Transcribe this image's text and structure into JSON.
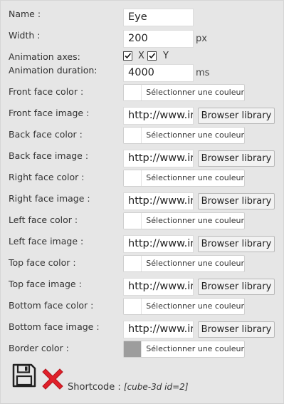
{
  "form": {
    "name": {
      "label": "Name :",
      "value": "Eye"
    },
    "width": {
      "label": "Width :",
      "value": "200",
      "unit": "px"
    },
    "animation_axes": {
      "label": "Animation axes:",
      "x_label": "X",
      "y_label": "Y",
      "x_checked": true,
      "y_checked": true
    },
    "animation_duration": {
      "label": "Animation duration:",
      "value": "4000",
      "unit": "ms"
    },
    "front_color": {
      "label": "Front face color :",
      "button": "Sélectionner une couleur"
    },
    "front_image": {
      "label": "Front face image :",
      "value": "http://www.in",
      "button": "Browser library"
    },
    "back_color": {
      "label": "Back face color :",
      "button": "Sélectionner une couleur"
    },
    "back_image": {
      "label": "Back face image :",
      "value": "http://www.in",
      "button": "Browser library"
    },
    "right_color": {
      "label": "Right face color :",
      "button": "Sélectionner une couleur"
    },
    "right_image": {
      "label": "Right face image :",
      "value": "http://www.in",
      "button": "Browser library"
    },
    "left_color": {
      "label": "Left face color :",
      "button": "Sélectionner une couleur"
    },
    "left_image": {
      "label": "Left face image :",
      "value": "http://www.in",
      "button": "Browser library"
    },
    "top_color": {
      "label": "Top face color :",
      "button": "Sélectionner une couleur"
    },
    "top_image": {
      "label": "Top face image :",
      "value": "http://www.in",
      "button": "Browser library"
    },
    "bottom_color": {
      "label": "Bottom face color :",
      "button": "Sélectionner une couleur"
    },
    "bottom_image": {
      "label": "Bottom face image :",
      "value": "http://www.in",
      "button": "Browser library"
    },
    "border_color": {
      "label": "Border color :",
      "button": "Sélectionner une couleur",
      "swatch": "#9d9d9d"
    }
  },
  "footer": {
    "save_icon": "save-icon",
    "delete_icon": "delete-icon",
    "shortcode_label": "Shortcode :",
    "shortcode_value": "[cube-3d id=2]"
  },
  "colors": {
    "delete": "#e0202a",
    "save": "#222222",
    "background": "#e6e6e6"
  }
}
